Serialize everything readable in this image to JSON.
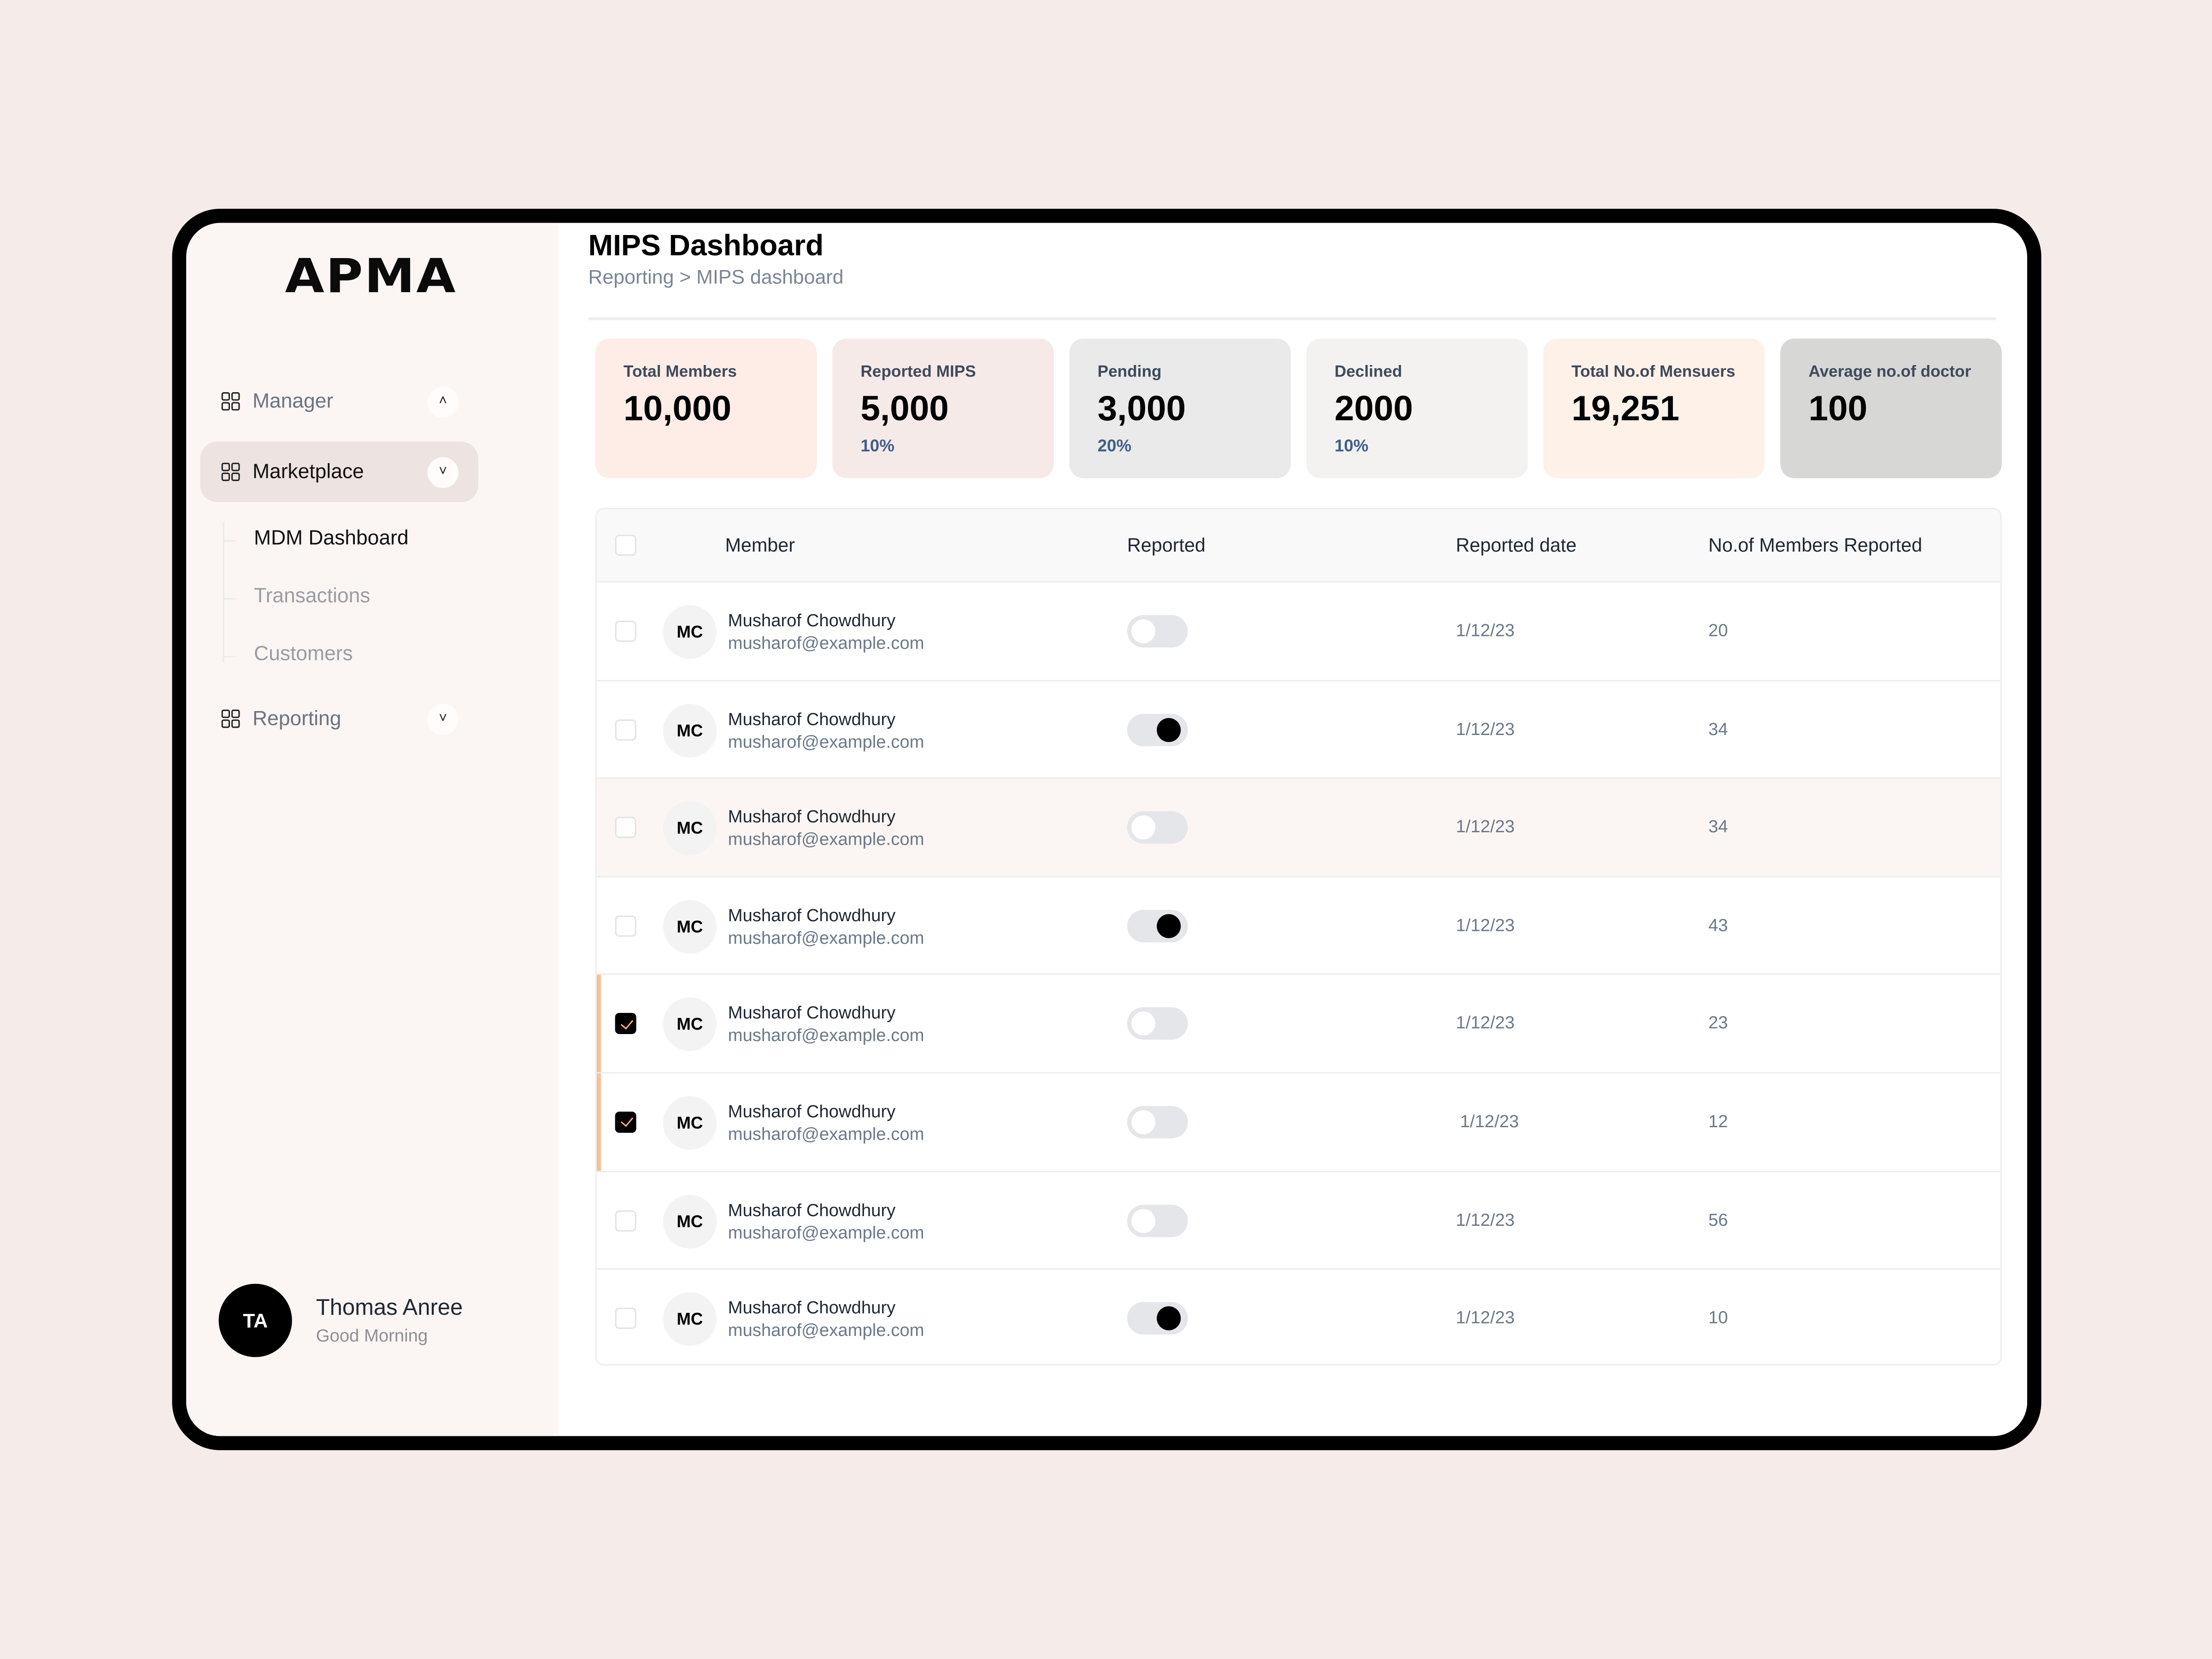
{
  "app": {
    "logo": "APMA"
  },
  "sidebar": {
    "items": [
      {
        "label": "Manager",
        "icon": "grid-icon",
        "chevron": "chevron-up-icon",
        "chevron_glyph": "˄",
        "active": false
      },
      {
        "label": "Marketplace",
        "icon": "grid-icon",
        "chevron": "chevron-down-icon",
        "chevron_glyph": "˅",
        "active": true
      },
      {
        "label": "Reporting",
        "icon": "grid-icon",
        "chevron": "chevron-down-icon",
        "chevron_glyph": "˅",
        "active": false
      }
    ],
    "sub_items": [
      {
        "label": "MDM Dashboard",
        "active": true
      },
      {
        "label": "Transactions",
        "active": false
      },
      {
        "label": "Customers",
        "active": false
      }
    ],
    "user": {
      "initials": "TA",
      "name": "Thomas Anree",
      "greeting": "Good Morning"
    }
  },
  "header": {
    "title": "MIPS Dashboard",
    "breadcrumb": "Reporting > MIPS dashboard"
  },
  "stats": [
    {
      "label": "Total Members",
      "value": "10,000",
      "pct": "",
      "bg": "#fdede6"
    },
    {
      "label": "Reported MIPS",
      "value": "5,000",
      "pct": "10%",
      "bg": "#f6eae8"
    },
    {
      "label": "Pending",
      "value": "3,000",
      "pct": "20%",
      "bg": "#e9eae9"
    },
    {
      "label": "Declined",
      "value": "2000",
      "pct": "10%",
      "bg": "#f3f2f1"
    },
    {
      "label": "Total No.of Mensuers",
      "value": "19,251",
      "pct": "",
      "bg": "#fdf1e8"
    },
    {
      "label": "Average no.of doctor",
      "value": "100",
      "pct": "",
      "bg": "#d7d7d6"
    }
  ],
  "table": {
    "columns": [
      "Member",
      "Reported",
      "Reported date",
      "No.of Members Reported"
    ],
    "rows": [
      {
        "initials": "MC",
        "name": "Musharof Chowdhury",
        "email": "musharof@example.com",
        "reported": false,
        "date": "1/12/23",
        "count": "20",
        "checked": false,
        "highlight": false
      },
      {
        "initials": "MC",
        "name": "Musharof Chowdhury",
        "email": "musharof@example.com",
        "reported": true,
        "date": "1/12/23",
        "count": "34",
        "checked": false,
        "highlight": false
      },
      {
        "initials": "MC",
        "name": "Musharof Chowdhury",
        "email": "musharof@example.com",
        "reported": false,
        "date": "1/12/23",
        "count": "34",
        "checked": false,
        "highlight": true
      },
      {
        "initials": "MC",
        "name": "Musharof Chowdhury",
        "email": "musharof@example.com",
        "reported": true,
        "date": "1/12/23",
        "count": "43",
        "checked": false,
        "highlight": false
      },
      {
        "initials": "MC",
        "name": "Musharof Chowdhury",
        "email": "musharof@example.com",
        "reported": false,
        "date": "1/12/23",
        "count": "23",
        "checked": true,
        "highlight": false
      },
      {
        "initials": "MC",
        "name": "Musharof Chowdhury",
        "email": "musharof@example.com",
        "reported": false,
        "date": "1/12/23",
        "count": "12",
        "checked": true,
        "highlight": false
      },
      {
        "initials": "MC",
        "name": "Musharof Chowdhury",
        "email": "musharof@example.com",
        "reported": false,
        "date": "1/12/23",
        "count": "56",
        "checked": false,
        "highlight": false
      },
      {
        "initials": "MC",
        "name": "Musharof Chowdhury",
        "email": "musharof@example.com",
        "reported": true,
        "date": "1/12/23",
        "count": "10",
        "checked": false,
        "highlight": false
      }
    ]
  },
  "colors": {
    "page_bg": "#f5ecea",
    "sidebar_bg": "#fbf6f4",
    "selected_accent": "#f6c197",
    "checkmark": "#f7b07a",
    "pct_text": "#3f5f8a"
  }
}
